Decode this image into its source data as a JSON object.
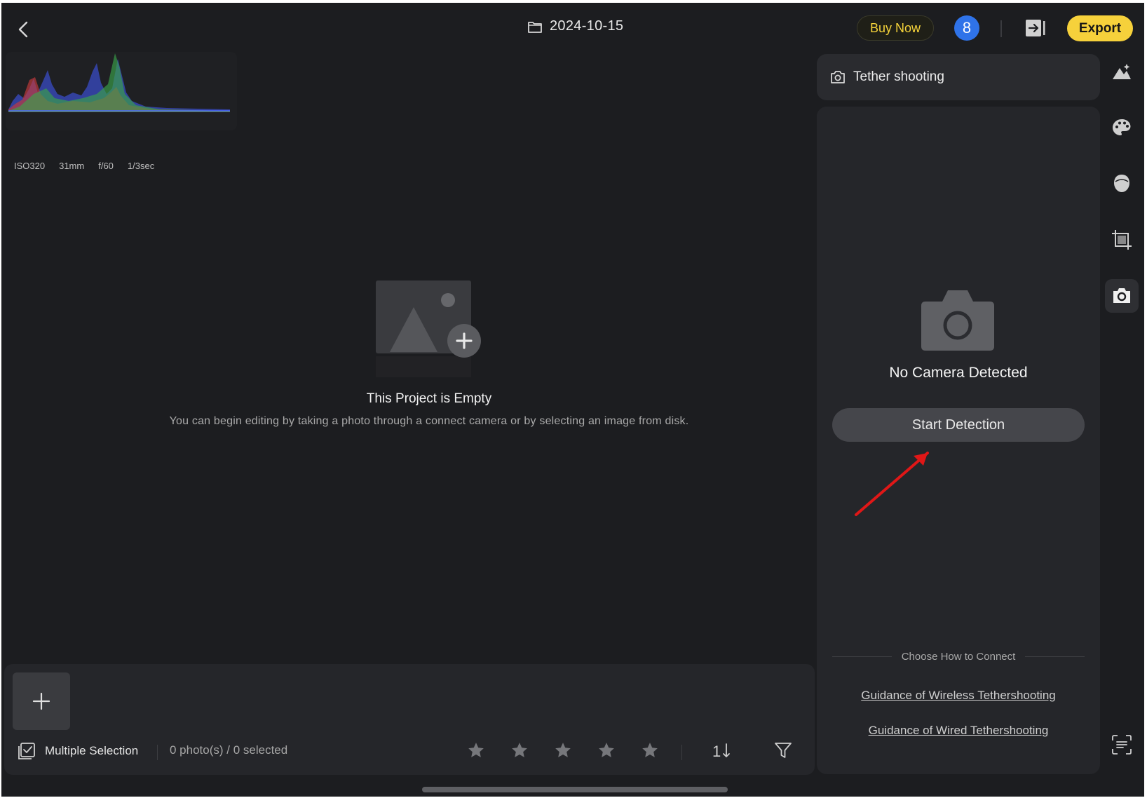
{
  "header": {
    "title": "2024-10-15",
    "buy_now_label": "Buy Now",
    "badge_count": "8",
    "export_label": "Export",
    "colors": {
      "accent": "#f6d13b",
      "badge": "#2f73e9"
    }
  },
  "histogram": {
    "exif": {
      "iso": "ISO320",
      "focal": "31mm",
      "aperture": "f/60",
      "shutter": "1/3sec"
    }
  },
  "main": {
    "empty_title": "This Project is Empty",
    "empty_subtitle": "You can begin editing by taking a photo through a connect camera or by selecting an image from disk."
  },
  "filmstrip": {
    "multi_selection_label": "Multiple Selection",
    "count_text": "0 photo(s) / 0 selected",
    "sort_label": "1"
  },
  "tether": {
    "header_label": "Tether shooting",
    "status": "No Camera Detected",
    "start_label": "Start Detection",
    "choose_label": "Choose How to Connect",
    "wireless_link": "Guidance of Wireless Tethershooting",
    "wired_link": "Guidance of Wired Tethershooting"
  },
  "rail": {
    "icons": [
      "landscape-icon",
      "palette-icon",
      "face-icon",
      "crop-icon",
      "camera-icon",
      "text-scan-icon"
    ],
    "active": "camera-icon"
  }
}
